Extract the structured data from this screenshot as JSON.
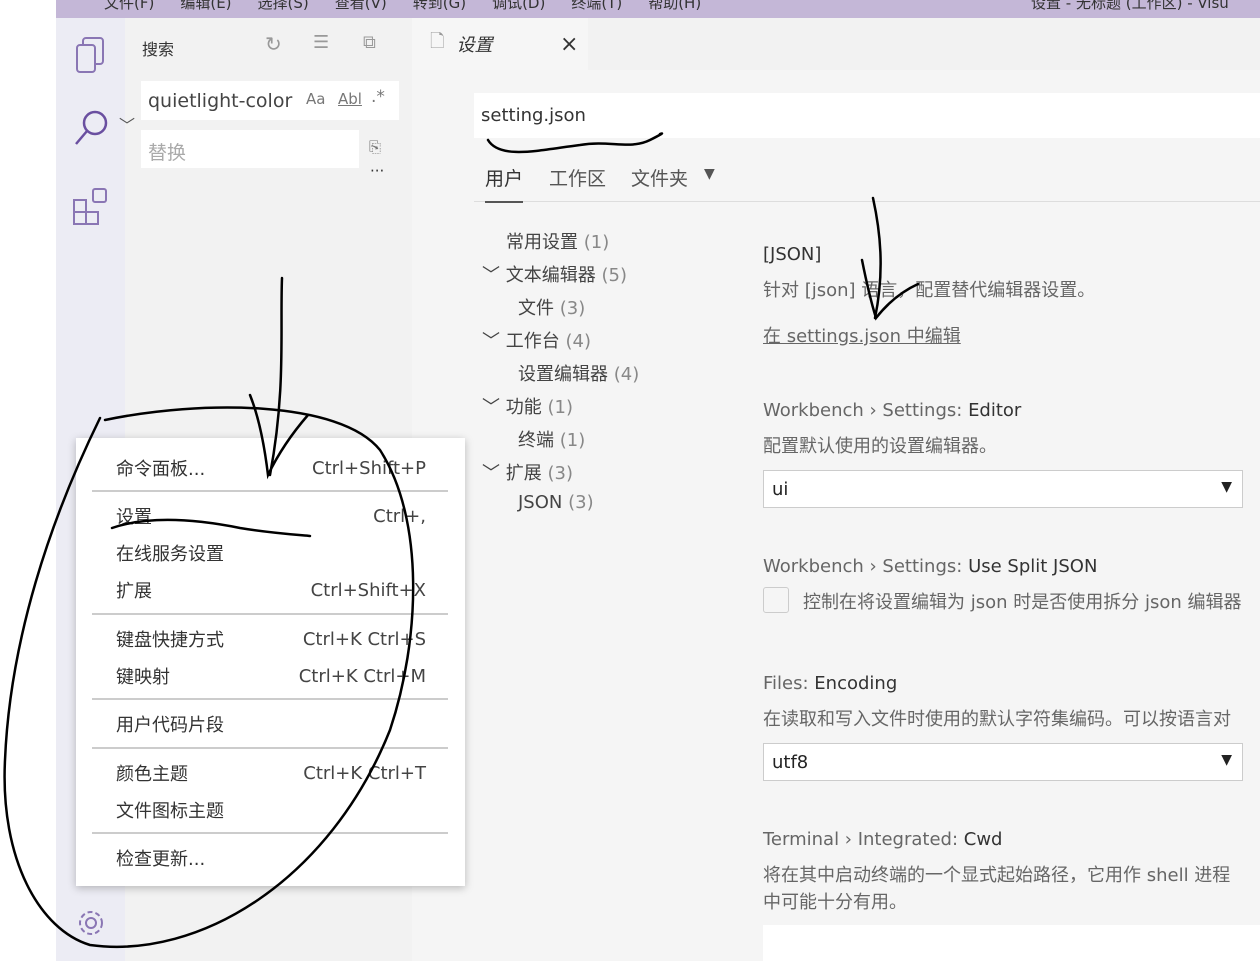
{
  "titlebar": {
    "menus": [
      "文件(F)",
      "编辑(E)",
      "选择(S)",
      "查看(V)",
      "转到(G)",
      "调试(D)",
      "终端(T)",
      "帮助(H)"
    ],
    "window_title": "设置 - 无标题 (工作区) - Visu"
  },
  "activity": [
    "files-icon",
    "search-icon",
    "extensions-icon",
    "gear-icon"
  ],
  "sidebar": {
    "title": "搜索",
    "search_value": "quietlight-color",
    "match_case": "Aa",
    "whole_word": "Abl",
    "regex": ".*",
    "replace_placeholder": "替换",
    "more": "···"
  },
  "tab": {
    "label": "设置",
    "close": "×"
  },
  "settings": {
    "search_value": "setting.json",
    "scopes": [
      "用户",
      "工作区",
      "文件夹"
    ],
    "toc": [
      {
        "label": "常用设置",
        "count": "(1)"
      },
      {
        "label": "文本编辑器",
        "count": "(5)"
      },
      {
        "label": "文件",
        "count": "(3)"
      },
      {
        "label": "工作台",
        "count": "(4)"
      },
      {
        "label": "设置编辑器",
        "count": "(4)"
      },
      {
        "label": "功能",
        "count": "(1)"
      },
      {
        "label": "终端",
        "count": "(1)"
      },
      {
        "label": "扩展",
        "count": "(3)"
      },
      {
        "label": "JSON",
        "count": "(3)"
      }
    ],
    "json": {
      "title": "[JSON]",
      "desc": "针对 [json] 语言，配置替代编辑器设置。",
      "link": "在 settings.json 中编辑"
    },
    "editor": {
      "prefix": "Workbench › Settings: ",
      "name": "Editor",
      "desc": "配置默认使用的设置编辑器。",
      "value": "ui"
    },
    "split": {
      "prefix": "Workbench › Settings: ",
      "name": "Use Split JSON",
      "desc": "控制在将设置编辑为 json 时是否使用拆分 json 编辑器",
      "checked": false
    },
    "encoding": {
      "prefix": "Files: ",
      "name": "Encoding",
      "desc": "在读取和写入文件时使用的默认字符集编码。可以按语言对",
      "value": "utf8"
    },
    "cwd": {
      "prefix": "Terminal › Integrated: ",
      "name": "Cwd",
      "desc1": "将在其中启动终端的一个显式起始路径，它用作 shell 进程",
      "desc2": "中可能十分有用。"
    }
  },
  "context_menu": [
    {
      "label": "命令面板...",
      "key": "Ctrl+Shift+P"
    },
    {
      "label": "设置",
      "key": "Ctrl+,"
    },
    {
      "label": "在线服务设置",
      "key": ""
    },
    {
      "label": "扩展",
      "key": "Ctrl+Shift+X"
    },
    {
      "label": "键盘快捷方式",
      "key": "Ctrl+K Ctrl+S"
    },
    {
      "label": "键映射",
      "key": "Ctrl+K Ctrl+M"
    },
    {
      "label": "用户代码片段",
      "key": ""
    },
    {
      "label": "颜色主题",
      "key": "Ctrl+K Ctrl+T"
    },
    {
      "label": "文件图标主题",
      "key": ""
    },
    {
      "label": "检查更新...",
      "key": ""
    }
  ],
  "colors": {
    "accent": "#7a5ea8",
    "titlebar": "#c4b7d7",
    "activity": "#ececf4"
  }
}
